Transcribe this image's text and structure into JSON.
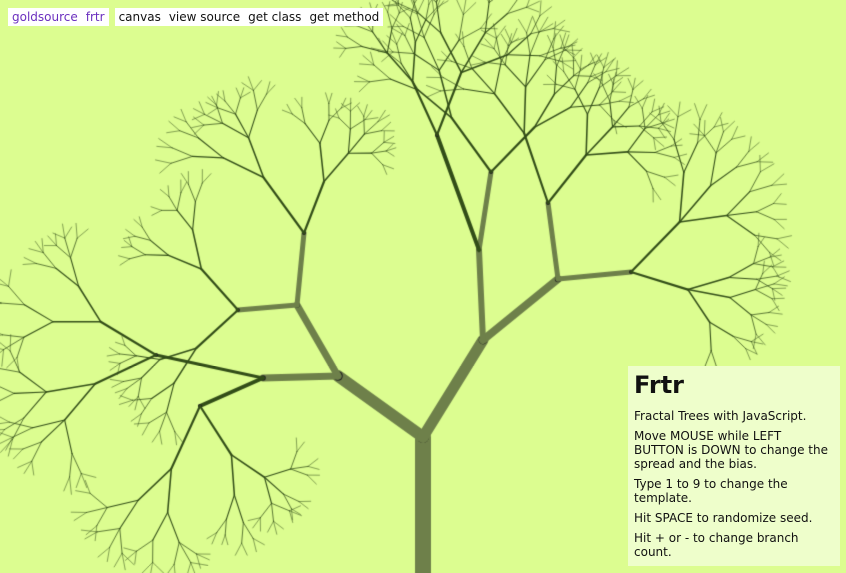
{
  "nav": {
    "links": [
      "goldsource",
      "frtr"
    ],
    "actions": [
      "canvas",
      "view source",
      "get class",
      "get method"
    ]
  },
  "panel": {
    "title": "Frtr",
    "lines": [
      "Fractal Trees with JavaScript.",
      "Move MOUSE while LEFT BUTTON is DOWN to change the spread and the bias.",
      "Type 1 to 9 to change the template.",
      "Hit SPACE to randomize seed.",
      "Hit + or - to change branch count."
    ]
  },
  "colors": {
    "background": "#dcfd90",
    "branch": "#324d18",
    "trunk": "#6e804a",
    "panel": "#eefecb",
    "link": "#6b2fbf"
  }
}
